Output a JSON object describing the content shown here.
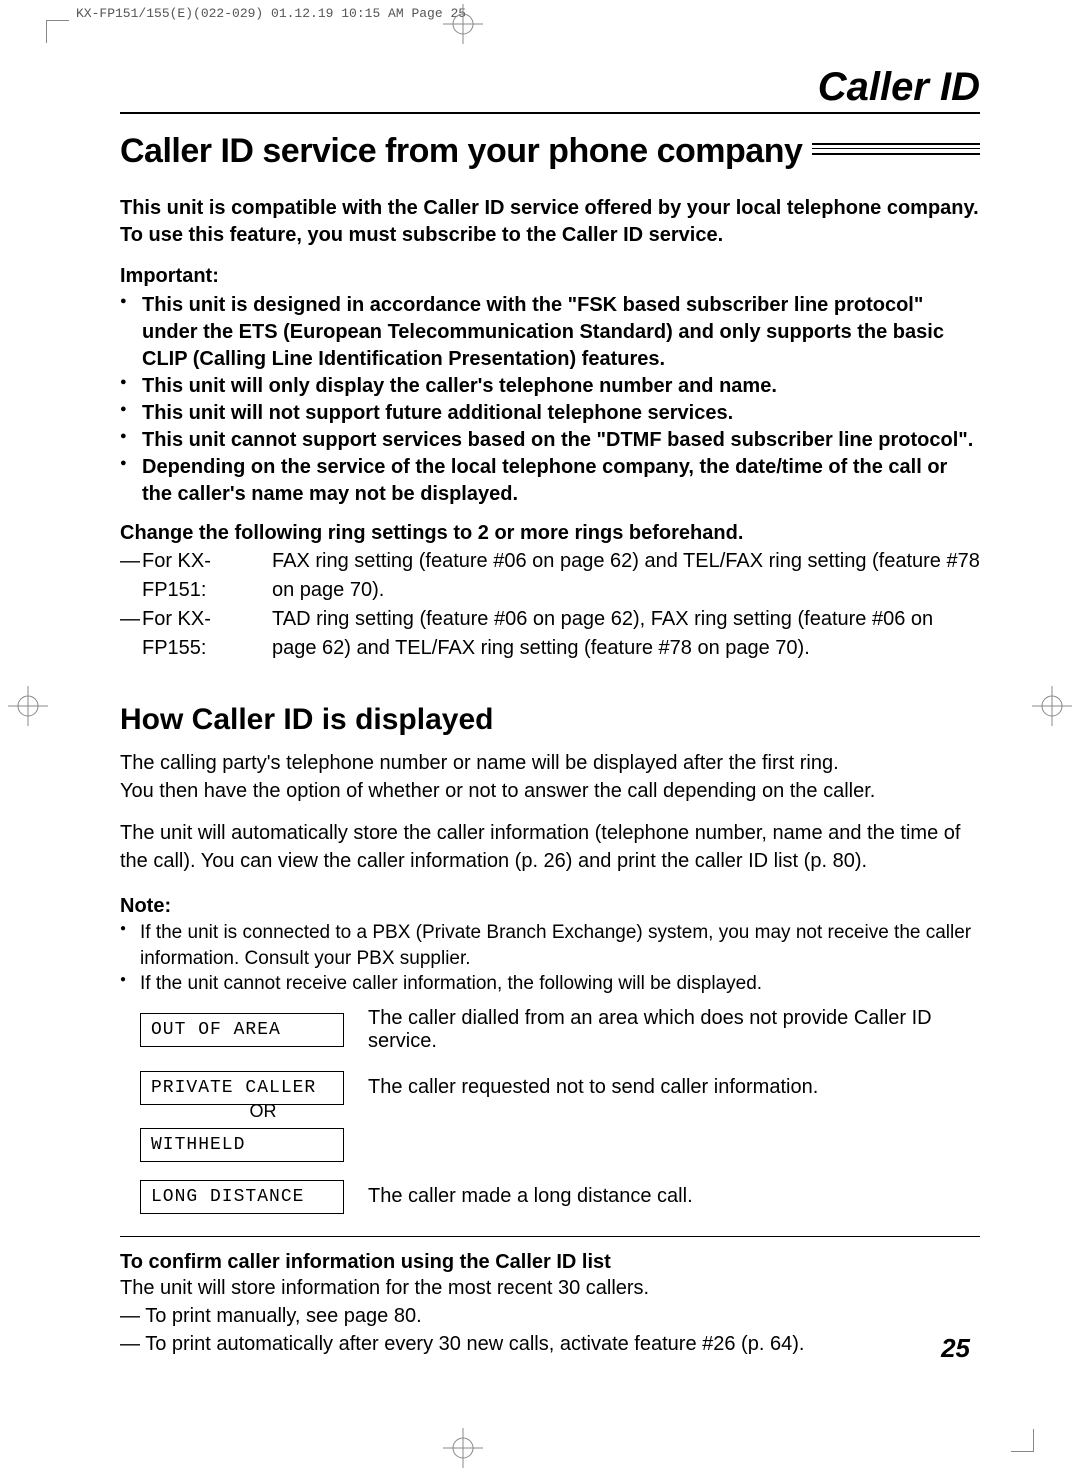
{
  "print_header": "KX-FP151/155(E)(022-029)  01.12.19 10:15 AM  Page 25",
  "section_header": "Caller ID",
  "main_title": "Caller ID service from your phone company",
  "intro": "This unit is compatible with the Caller ID service offered by your local telephone company. To use this feature, you must subscribe to the Caller ID service.",
  "important_label": "Important:",
  "important_bullets": [
    "This unit is designed in accordance with the \"FSK based subscriber line protocol\" under the ETS (European Telecommunication Standard) and only supports the basic CLIP (Calling Line Identification Presentation) features.",
    "This unit will only display the caller's telephone number and name.",
    "This unit will not support future additional telephone services.",
    "This unit cannot support services based on the \"DTMF based subscriber line protocol\".",
    "Depending on the service of the local telephone company, the date/time of the call or the caller's name may not be displayed."
  ],
  "ring_heading": "Change the following ring settings to 2 or more rings beforehand.",
  "ring_items": [
    {
      "model": "For KX-FP151:",
      "text": "FAX ring setting (feature #06 on page 62) and TEL/FAX ring setting (feature #78 on page 70)."
    },
    {
      "model": "For KX-FP155:",
      "text": "TAD ring setting (feature #06 on page 62), FAX ring setting (feature #06 on page 62) and TEL/FAX ring setting (feature #78 on page 70)."
    }
  ],
  "sub_title": "How Caller ID is displayed",
  "body1": "The calling party's telephone number or name will be displayed after the first ring.\nYou then have the option of whether or not to answer the call depending on the caller.",
  "body2": "The unit will automatically store the caller information (telephone number, name and the time of the call). You can view the caller information (p. 26) and print the caller ID list (p. 80).",
  "note_label": "Note:",
  "note_bullets": [
    "If the unit is connected to a PBX (Private Branch Exchange) system, you may not receive the caller information. Consult your PBX supplier.",
    "If the unit cannot receive caller information, the following will be displayed."
  ],
  "displays": {
    "out_of_area": {
      "lcd": "OUT OF AREA",
      "desc": "The caller dialled from an area which does not provide Caller ID service."
    },
    "private": {
      "lcd": "PRIVATE CALLER",
      "desc": "The caller requested not to send caller information."
    },
    "or_label": "OR",
    "withheld": {
      "lcd": "WITHHELD"
    },
    "long_dist": {
      "lcd": "LONG DISTANCE",
      "desc": "The caller made a long distance call."
    }
  },
  "confirm_heading": "To confirm caller information using the Caller ID list",
  "confirm_body": "The unit will store information for the most recent 30 callers.",
  "confirm_dashes": [
    "— To print manually, see page 80.",
    "— To print automatically after every 30 new calls, activate feature #26 (p. 64)."
  ],
  "page_number": "25"
}
